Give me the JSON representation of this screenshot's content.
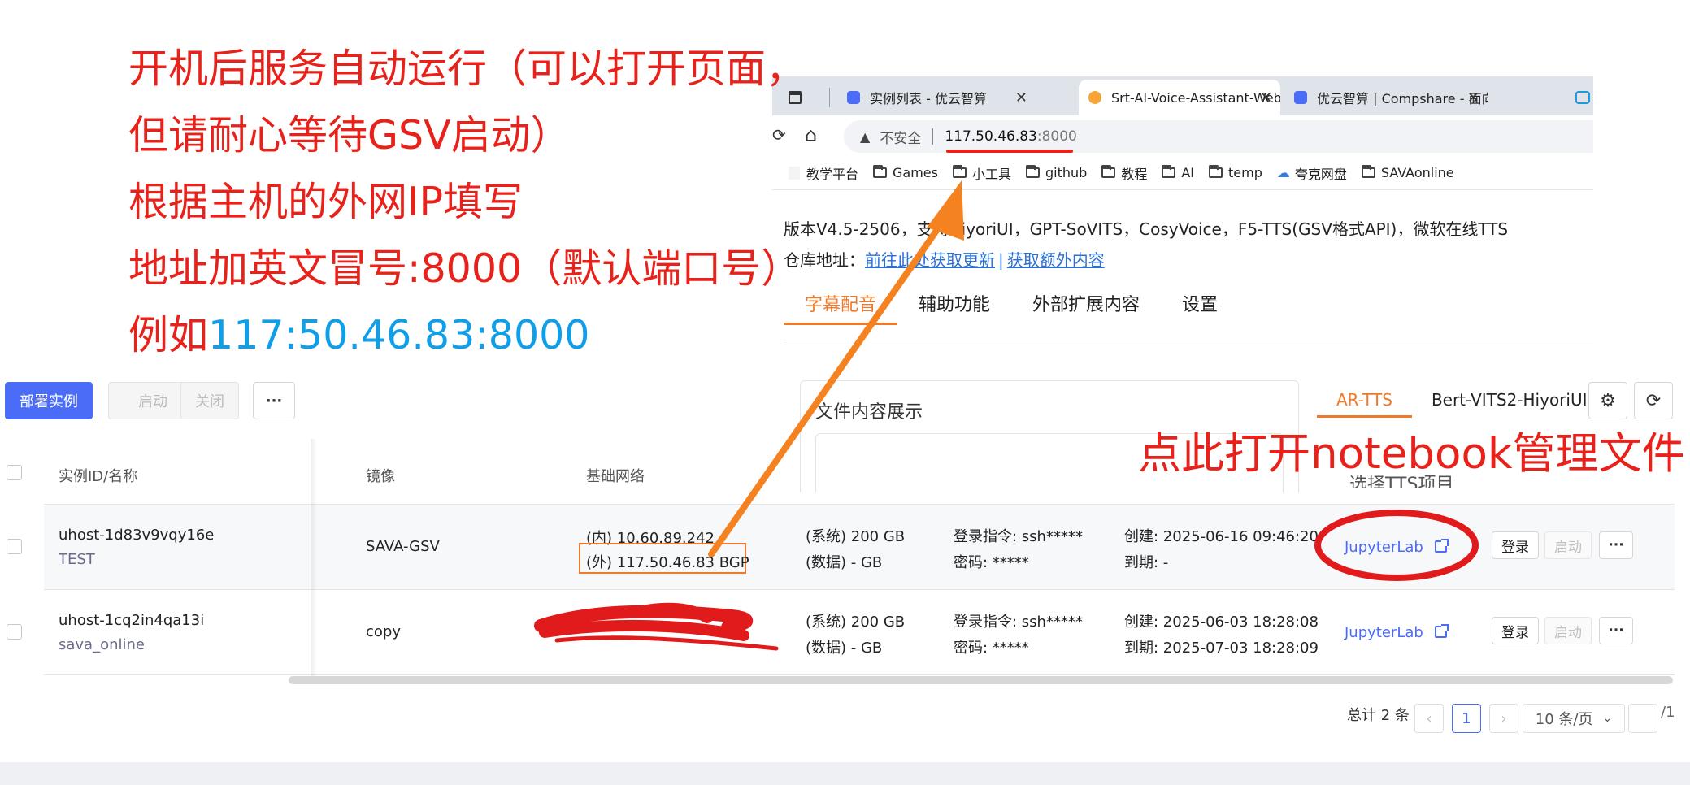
{
  "annotation": {
    "lines": [
      "开机后服务自动运行（可以打开页面，",
      "但请耐心等待GSV启动）",
      "根据主机的外网IP填写",
      "地址加英文冒号:8000（默认端口号）"
    ],
    "example_prefix": "例如",
    "example_ip": "117:50.46.83:8000",
    "notebook_hint": "点此打开notebook管理文件"
  },
  "browser": {
    "tabs": [
      {
        "label": "实例列表 - 优云智算",
        "active": false
      },
      {
        "label": "Srt-AI-Voice-Assistant-WebUI",
        "active": true
      },
      {
        "label": "优云智算 | Compshare - 面向AI场",
        "active": false
      }
    ],
    "address": {
      "insecure_label": "不安全",
      "host": "117.50.46.83",
      "port": ":8000"
    },
    "bookmarks": [
      {
        "label": "教学平台",
        "icon": "blank-page-icon"
      },
      {
        "label": "Games",
        "icon": "folder-icon"
      },
      {
        "label": "小工具",
        "icon": "folder-icon"
      },
      {
        "label": "github",
        "icon": "folder-icon"
      },
      {
        "label": "教程",
        "icon": "folder-icon"
      },
      {
        "label": "AI",
        "icon": "folder-icon"
      },
      {
        "label": "temp",
        "icon": "folder-icon"
      },
      {
        "label": "夸克网盘",
        "icon": "cloud-icon"
      },
      {
        "label": "SAVAonline",
        "icon": "folder-icon"
      }
    ],
    "page": {
      "version_text": "版本V4.5-2506，支持HiyoriUI，GPT-SoVITS，CosyVoice，F5-TTS(GSV格式API)，微软在线TTS",
      "repo_label": "仓库地址：",
      "repo_link_1": "前往此处获取更新",
      "repo_sep": "|",
      "repo_link_2": "获取额外内容",
      "nav_tabs": [
        "字幕配音",
        "辅助功能",
        "外部扩展内容",
        "设置"
      ],
      "file_panel_title": "文件内容展示",
      "side_tabs": [
        "AR-TTS",
        "Bert-VITS2-HiyoriUI"
      ],
      "side_hint": "选择TTS项目"
    }
  },
  "console": {
    "toolbar": {
      "deploy": "部署实例",
      "start": "启动",
      "stop": "关闭",
      "more": "···"
    },
    "headers": {
      "id_name": "实例ID/名称",
      "image": "镜像",
      "network": "基础网络"
    },
    "rows": [
      {
        "id": "uhost-1d83v9vqy16e",
        "name": "TEST",
        "image": "SAVA-GSV",
        "net_inner": "(内) 10.60.89.242",
        "net_outer": "(外) 117.50.46.83  BGP",
        "disk_sys": "(系统) 200 GB",
        "disk_data": "(数据) - GB",
        "login_cmd": "登录指令:  ssh*****",
        "password": "密码:  *****",
        "created": "创建: 2025-06-16 09:46:20",
        "expires": "到期: -",
        "jupyter": "JupyterLab",
        "login_btn": "登录",
        "start_btn": "启动",
        "more_btn": "···"
      },
      {
        "id": "uhost-1cq2in4qa13i",
        "name": "sava_online",
        "image": "copy",
        "disk_sys": "(系统) 200 GB",
        "disk_data": "(数据) - GB",
        "login_cmd": "登录指令:  ssh*****",
        "password": "密码:  *****",
        "created": "创建: 2025-06-03 18:28:08",
        "expires": "到期: 2025-07-03 18:28:09",
        "jupyter": "JupyterLab",
        "login_btn": "登录",
        "start_btn": "启动",
        "more_btn": "···"
      }
    ],
    "pagination": {
      "total": "总计 2 条",
      "prev": "‹",
      "current": "1",
      "next": "›",
      "page_size": "10 条/页",
      "total_pages": "/1"
    }
  },
  "colors": {
    "annotation_red": "#e8221b",
    "ip_blue": "#0f9ee8",
    "arrow_orange": "#f58220",
    "primary_blue": "#4a6cf7",
    "active_orange": "#f07a2b"
  }
}
